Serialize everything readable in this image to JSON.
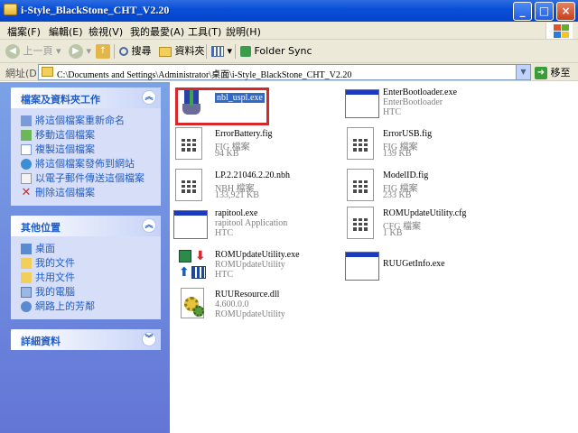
{
  "window": {
    "title": "i-Style_BlackStone_CHT_V2.20",
    "minimize": "_",
    "maximize": "□",
    "close": "×"
  },
  "menu": [
    "檔案(F)",
    "編輯(E)",
    "檢視(V)",
    "我的最愛(A)",
    "工具(T)",
    "說明(H)"
  ],
  "toolbar": {
    "back": "上一頁",
    "search": "搜尋",
    "folders": "資料夾",
    "folder_sync": "Folder Sync"
  },
  "address": {
    "label": "網址(D)",
    "path": "C:\\Documents and Settings\\Administrator\\桌面\\i-Style_BlackStone_CHT_V2.20",
    "go": "移至"
  },
  "tasks_panel": {
    "title": "檔案及資料夾工作",
    "items": [
      "將這個檔案重新命名",
      "移動這個檔案",
      "複製這個檔案",
      "將這個檔案發佈到網站",
      "以電子郵件傳送這個檔案",
      "刪除這個檔案"
    ]
  },
  "places_panel": {
    "title": "其他位置",
    "items": [
      "桌面",
      "我的文件",
      "共用文件",
      "我的電腦",
      "網路上的芳鄰"
    ]
  },
  "details_panel": {
    "title": "詳細資料"
  },
  "files": [
    {
      "name": "nbl_uspl.exe",
      "sub1": "",
      "sub2": "",
      "icon": "usb-exe-icon"
    },
    {
      "name": "EnterBootloader.exe",
      "sub1": "EnterBootloader",
      "sub2": "HTC",
      "icon": "window-exe-icon"
    },
    {
      "name": "ErrorBattery.fig",
      "sub1": "FIG 檔案",
      "sub2": "94 KB",
      "icon": "document-icon"
    },
    {
      "name": "ErrorUSB.fig",
      "sub1": "FIG 檔案",
      "sub2": "139 KB",
      "icon": "document-icon"
    },
    {
      "name": "LP.2.21046.2.20.nbh",
      "sub1": "NBH 檔案",
      "sub2": "133,921 KB",
      "icon": "document-icon"
    },
    {
      "name": "ModelID.fig",
      "sub1": "FIG 檔案",
      "sub2": "233 KB",
      "icon": "document-icon"
    },
    {
      "name": "rapitool.exe",
      "sub1": "rapitool Application",
      "sub2": "HTC",
      "icon": "window-exe-icon"
    },
    {
      "name": "ROMUpdateUtility.cfg",
      "sub1": "CFG 檔案",
      "sub2": "1 KB",
      "icon": "document-icon"
    },
    {
      "name": "ROMUpdateUtility.exe",
      "sub1": "ROMUpdateUtility",
      "sub2": "HTC",
      "icon": "ruu-exe-icon"
    },
    {
      "name": "RUUGetInfo.exe",
      "sub1": "",
      "sub2": "",
      "icon": "window-exe-icon"
    },
    {
      "name": "RUUResource.dll",
      "sub1": "4.600.0.0",
      "sub2": "ROMUpdateUtility",
      "icon": "dll-icon"
    }
  ]
}
